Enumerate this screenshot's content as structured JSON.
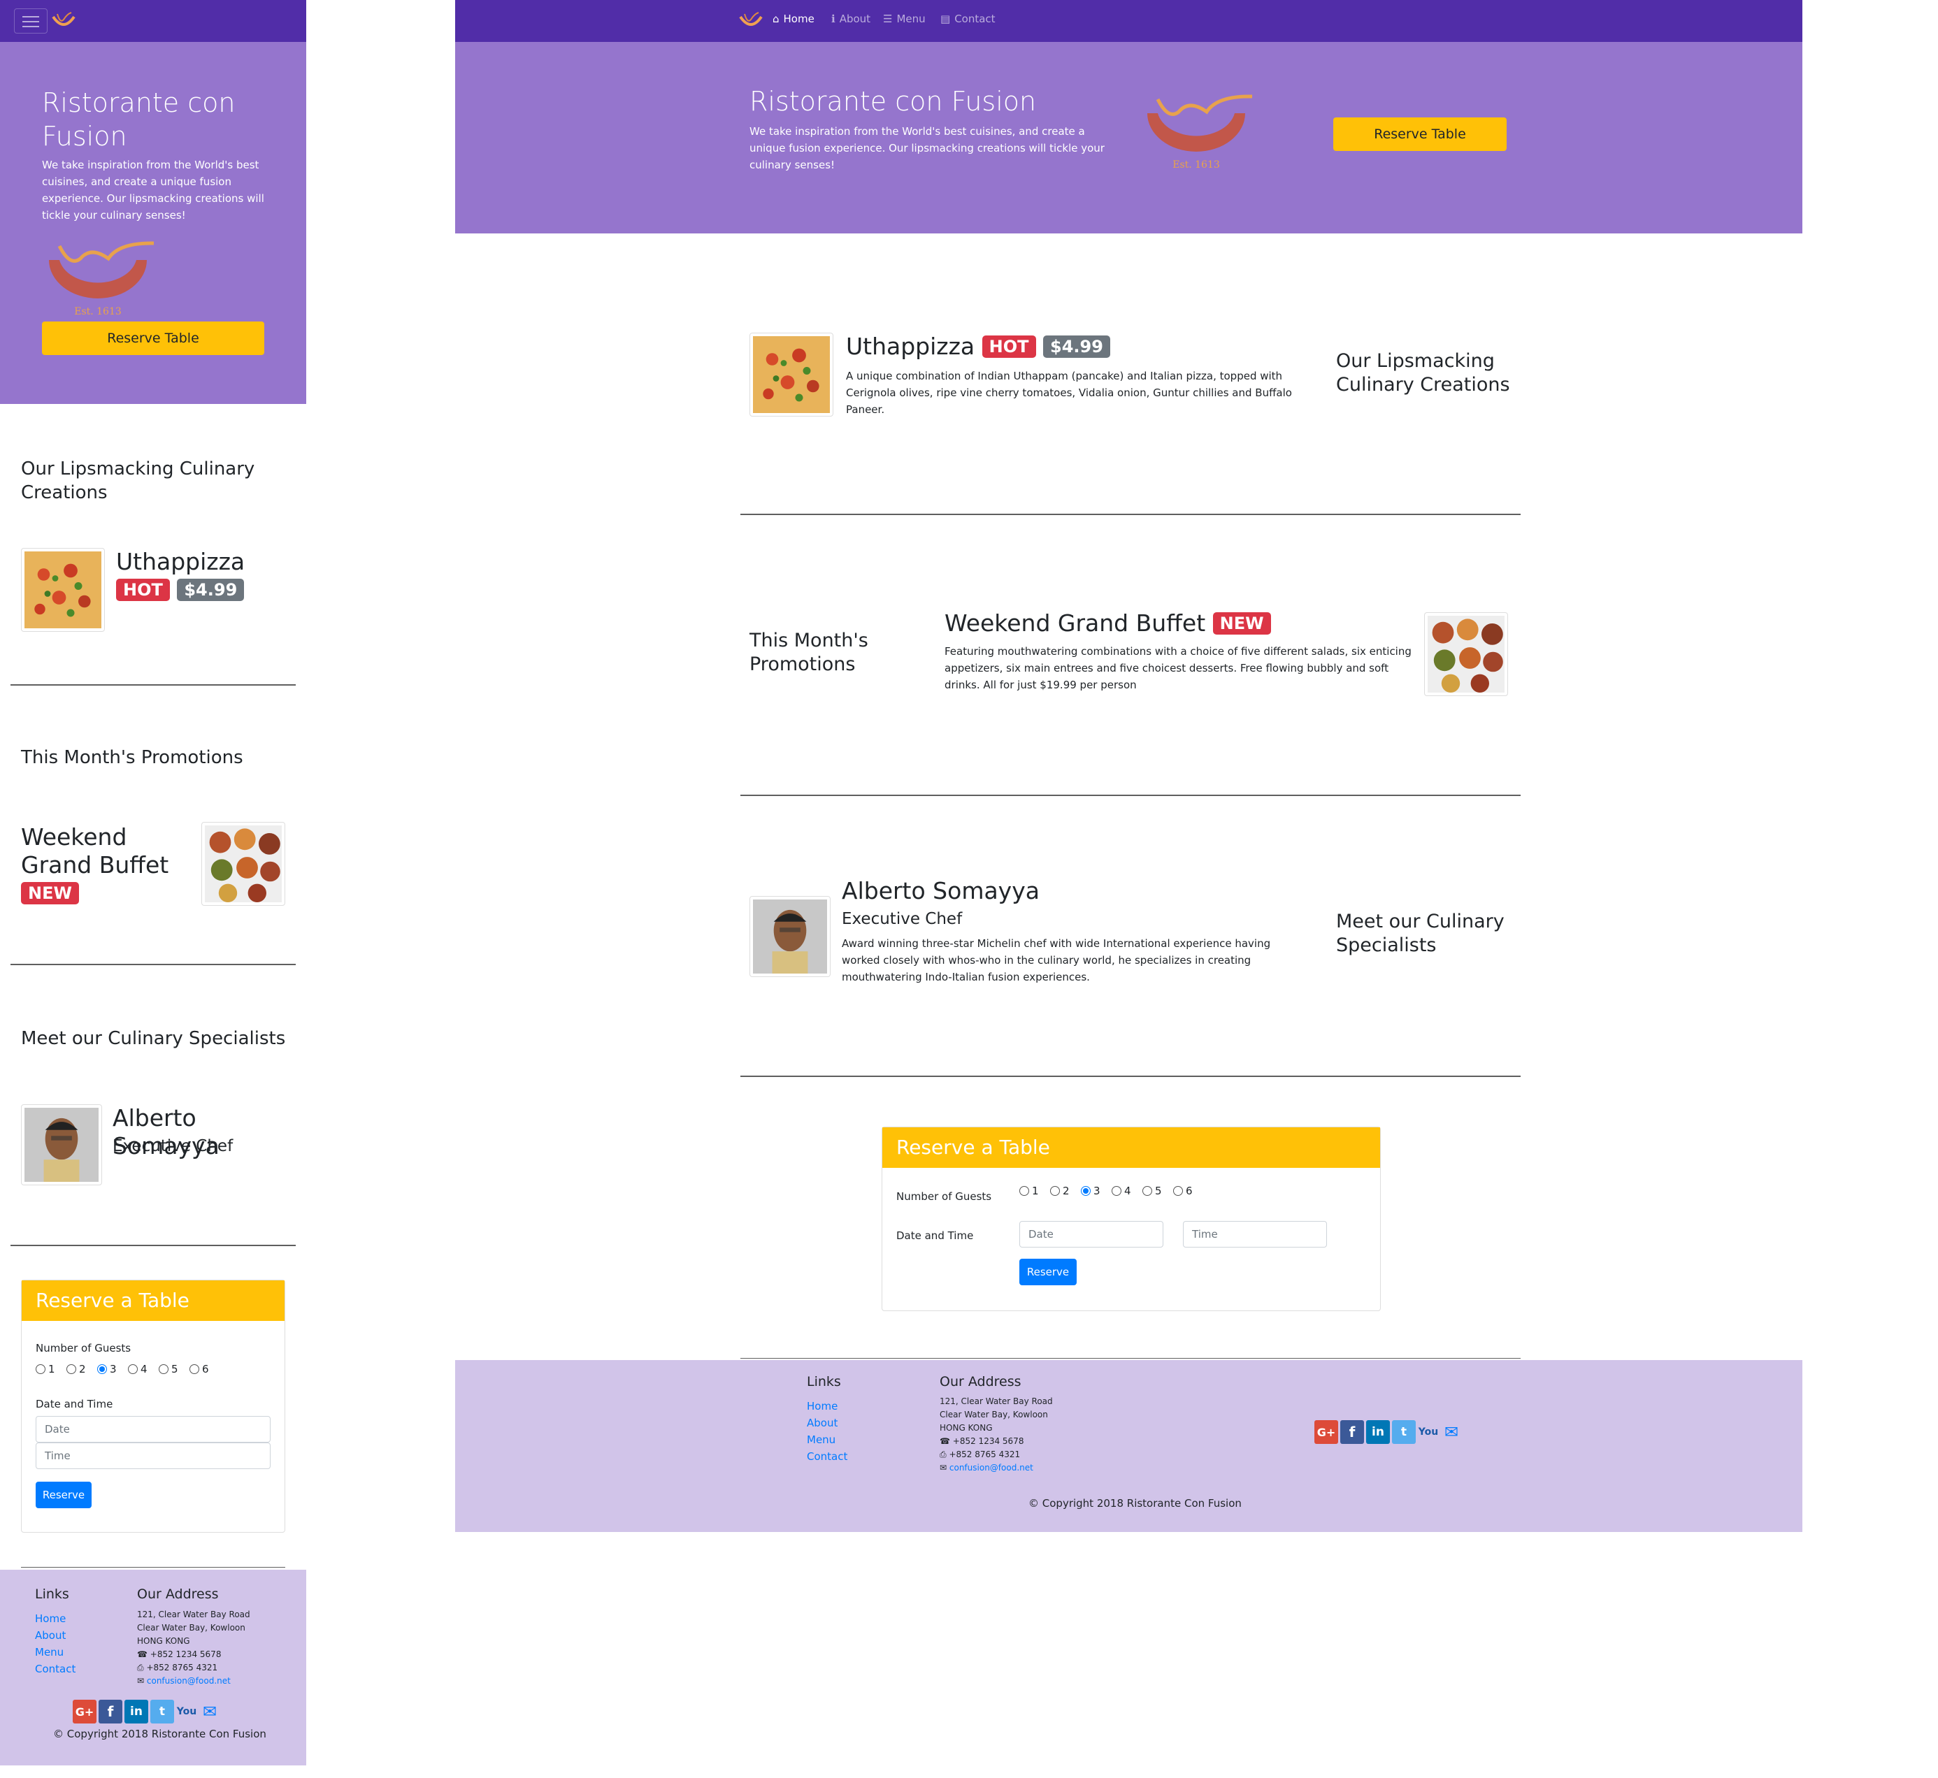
{
  "brand": {
    "name": "Ristorante con Fusion",
    "tagline": "We take inspiration from the World's best cuisines, and create a unique fusion experience. Our lipsmacking creations will tickle your culinary senses!",
    "logo_text": "Ristorante con Fusion",
    "logo_est": "Est. 1613"
  },
  "nav": {
    "items": [
      {
        "label": "Home",
        "icon": "home-icon",
        "active": true
      },
      {
        "label": "About",
        "icon": "info-icon"
      },
      {
        "label": "Menu",
        "icon": "list-icon"
      },
      {
        "label": "Contact",
        "icon": "address-card-icon"
      }
    ]
  },
  "reserve_btn": "Reserve Table",
  "sections": {
    "dish": {
      "title": "Our Lipsmacking Culinary Creations",
      "name": "Uthappizza",
      "badge": "HOT",
      "price": "$4.99",
      "description": "A unique combination of Indian Uthappam (pancake) and Italian pizza, topped with Cerignola olives, ripe vine cherry tomatoes, Vidalia onion, Guntur chillies and Buffalo Paneer."
    },
    "promo": {
      "title": "This Month's Promotions",
      "name": "Weekend Grand Buffet",
      "badge": "NEW",
      "description": "Featuring mouthwatering combinations with a choice of five different salads, six enticing appetizers, six main entrees and five choicest desserts. Free flowing bubbly and soft drinks. All for just $19.99 per person"
    },
    "leader": {
      "title": "Meet our Culinary Specialists",
      "name": "Alberto Somayya",
      "role": "Executive Chef",
      "description": "Award winning three-star Michelin chef with wide International experience having worked closely with whos-who in the culinary world, he specializes in creating mouthwatering Indo-Italian fusion experiences."
    }
  },
  "reserve": {
    "header": "Reserve a Table",
    "guests_label": "Number of Guests",
    "guest_options": [
      "1",
      "2",
      "3",
      "4",
      "5",
      "6"
    ],
    "selected": "3",
    "datetime_label": "Date and Time",
    "date_placeholder": "Date",
    "time_placeholder": "Time",
    "submit": "Reserve"
  },
  "footer": {
    "links_title": "Links",
    "links": [
      "Home",
      "About",
      "Menu",
      "Contact"
    ],
    "address_title": "Our Address",
    "address_lines": [
      "121, Clear Water Bay Road",
      "Clear Water Bay, Kowloon",
      "HONG KONG"
    ],
    "phone": "+852 1234 5678",
    "fax": "+852 8765 4321",
    "email": "confusion@food.net",
    "copyright": "© Copyright 2018 Ristorante Con Fusion"
  },
  "colors": {
    "navbar": "#512da8",
    "jumbotron": "#9575cd",
    "footer": "#d1c4e9",
    "warning": "#ffc107",
    "danger": "#dc3545",
    "primary": "#007bff"
  }
}
